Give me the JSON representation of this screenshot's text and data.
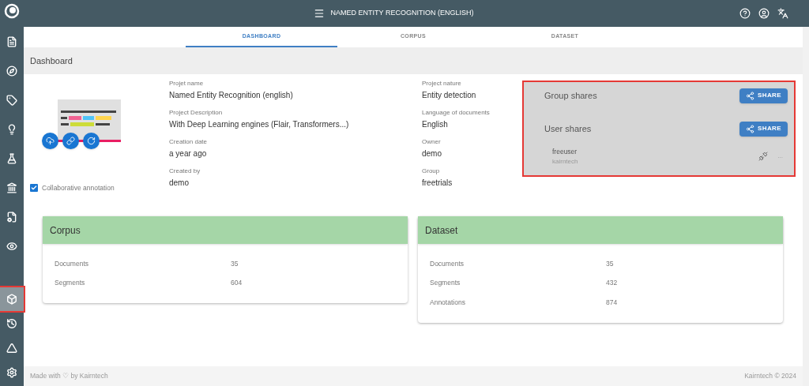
{
  "topbar": {
    "title": "NAMED ENTITY RECOGNITION (ENGLISH)"
  },
  "sidebar": {
    "top_items": [
      {
        "kind": "documents",
        "selected": false
      },
      {
        "kind": "compass",
        "selected": false
      },
      {
        "kind": "tag",
        "selected": false
      },
      {
        "kind": "bulb",
        "selected": false
      },
      {
        "kind": "flask",
        "selected": false
      },
      {
        "kind": "bank",
        "selected": false
      },
      {
        "kind": "file-gear",
        "selected": false
      },
      {
        "kind": "eye",
        "selected": false
      }
    ],
    "bottom_items": [
      {
        "kind": "cube",
        "selected": true
      },
      {
        "kind": "history",
        "selected": false
      },
      {
        "kind": "triangle",
        "selected": false
      },
      {
        "kind": "settings",
        "selected": false
      }
    ]
  },
  "tabs": [
    {
      "label": "DASHBOARD",
      "selected": true
    },
    {
      "label": "CORPUS",
      "selected": false
    },
    {
      "label": "DATASET",
      "selected": false
    }
  ],
  "page_title": "Dashboard",
  "project": {
    "collaborative_annotation": {
      "label": "Collaborative annotation",
      "checked": true
    },
    "left_fields": [
      {
        "label": "Projet name",
        "value": "Named Entity Recognition (english)"
      },
      {
        "label": "Project Description",
        "value": "With Deep Learning engines (Flair, Transformers...)"
      },
      {
        "label": "Creation date",
        "value": "a year ago"
      },
      {
        "label": "Created by",
        "value": "demo"
      }
    ],
    "right_fields": [
      {
        "label": "Project nature",
        "value": "Entity detection"
      },
      {
        "label": "Language of documents",
        "value": "English"
      },
      {
        "label": "Owner",
        "value": "demo"
      },
      {
        "label": "Group",
        "value": "freetrials"
      }
    ]
  },
  "shares": {
    "group": {
      "title": "Group shares",
      "button": "SHARE"
    },
    "user": {
      "title": "User shares",
      "button": "SHARE"
    },
    "users": [
      {
        "name": "freeuser",
        "group": "kairntech",
        "more": "..."
      }
    ]
  },
  "cards": [
    {
      "title": "Corpus",
      "rows": [
        {
          "label": "Documents",
          "value": "35"
        },
        {
          "label": "Segments",
          "value": "604"
        }
      ]
    },
    {
      "title": "Dataset",
      "rows": [
        {
          "label": "Documents",
          "value": "35"
        },
        {
          "label": "Segments",
          "value": "432"
        },
        {
          "label": "Annotations",
          "value": "874"
        }
      ]
    }
  ],
  "footer": {
    "left": "Made with ♡ by Kairntech",
    "right": "Kairntech © 2024"
  }
}
